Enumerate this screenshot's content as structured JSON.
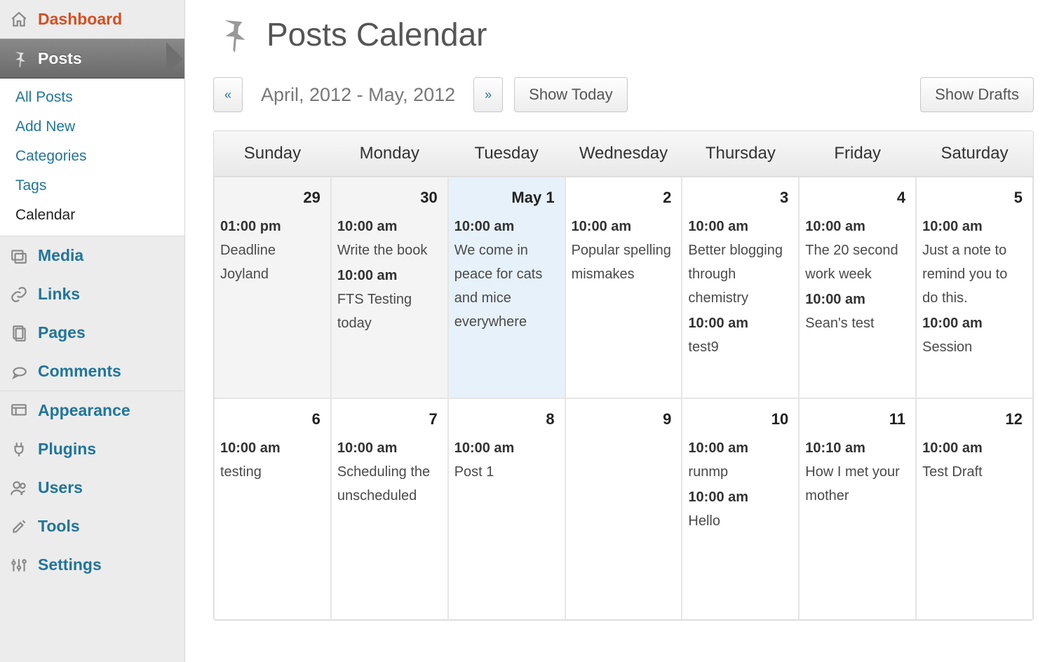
{
  "page": {
    "title": "Posts Calendar"
  },
  "sidebar": {
    "top": [
      {
        "id": "dashboard",
        "label": "Dashboard",
        "icon": "home"
      }
    ],
    "active": {
      "id": "posts",
      "label": "Posts",
      "icon": "pin"
    },
    "sub": [
      {
        "id": "all-posts",
        "label": "All Posts",
        "current": false
      },
      {
        "id": "add-new",
        "label": "Add New",
        "current": false
      },
      {
        "id": "categories",
        "label": "Categories",
        "current": false
      },
      {
        "id": "tags",
        "label": "Tags",
        "current": false
      },
      {
        "id": "calendar",
        "label": "Calendar",
        "current": true
      }
    ],
    "bottom": [
      {
        "id": "media",
        "label": "Media",
        "icon": "media"
      },
      {
        "id": "links",
        "label": "Links",
        "icon": "link"
      },
      {
        "id": "pages",
        "label": "Pages",
        "icon": "pages"
      },
      {
        "id": "comments",
        "label": "Comments",
        "icon": "comment"
      },
      {
        "id": "appearance",
        "label": "Appearance",
        "icon": "appearance"
      },
      {
        "id": "plugins",
        "label": "Plugins",
        "icon": "plug"
      },
      {
        "id": "users",
        "label": "Users",
        "icon": "users"
      },
      {
        "id": "tools",
        "label": "Tools",
        "icon": "tools"
      },
      {
        "id": "settings",
        "label": "Settings",
        "icon": "settings"
      }
    ]
  },
  "toolbar": {
    "prev": "«",
    "next": "»",
    "range": "April, 2012 - May, 2012",
    "show_today": "Show Today",
    "show_drafts": "Show Drafts"
  },
  "calendar": {
    "days": [
      "Sunday",
      "Monday",
      "Tuesday",
      "Wednesday",
      "Thursday",
      "Friday",
      "Saturday"
    ],
    "weeks": [
      [
        {
          "label": "29",
          "other": true,
          "events": [
            {
              "time": "01:00 pm",
              "title": "Deadline Joyland"
            }
          ]
        },
        {
          "label": "30",
          "other": true,
          "events": [
            {
              "time": "10:00 am",
              "title": "Write the book"
            },
            {
              "time": "10:00 am",
              "title": "FTS Testing today"
            }
          ]
        },
        {
          "label": "May 1",
          "today": true,
          "events": [
            {
              "time": "10:00 am",
              "title": "We come in peace for cats and mice everywhere"
            }
          ]
        },
        {
          "label": "2",
          "events": [
            {
              "time": "10:00 am",
              "title": "Popular spelling mismakes"
            }
          ]
        },
        {
          "label": "3",
          "events": [
            {
              "time": "10:00 am",
              "title": "Better blogging through chemistry"
            },
            {
              "time": "10:00 am",
              "title": "test9"
            }
          ]
        },
        {
          "label": "4",
          "events": [
            {
              "time": "10:00 am",
              "title": "The 20 second work week"
            },
            {
              "time": "10:00 am",
              "title": "Sean's test"
            }
          ]
        },
        {
          "label": "5",
          "events": [
            {
              "time": "10:00 am",
              "title": "Just a note to remind you to do this."
            },
            {
              "time": "10:00 am",
              "title": "Session"
            }
          ]
        }
      ],
      [
        {
          "label": "6",
          "events": [
            {
              "time": "10:00 am",
              "title": "testing"
            }
          ]
        },
        {
          "label": "7",
          "events": [
            {
              "time": "10:00 am",
              "title": "Scheduling the unscheduled"
            }
          ]
        },
        {
          "label": "8",
          "events": [
            {
              "time": "10:00 am",
              "title": "Post 1"
            }
          ]
        },
        {
          "label": "9",
          "events": []
        },
        {
          "label": "10",
          "events": [
            {
              "time": "10:00 am",
              "title": "runmp"
            },
            {
              "time": "10:00 am",
              "title": "Hello"
            }
          ]
        },
        {
          "label": "11",
          "events": [
            {
              "time": "10:10 am",
              "title": "How I met your mother"
            }
          ]
        },
        {
          "label": "12",
          "events": [
            {
              "time": "10:00 am",
              "title": "Test Draft"
            }
          ]
        }
      ]
    ]
  }
}
